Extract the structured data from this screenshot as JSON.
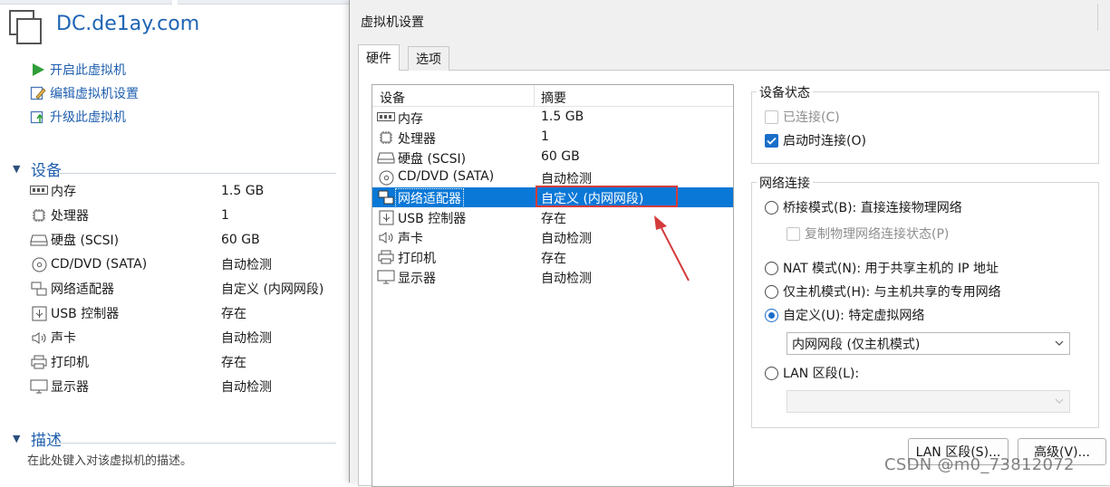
{
  "vm": {
    "title": "DC.de1ay.com"
  },
  "actions": [
    {
      "label": "开启此虚拟机",
      "icon": "play-icon"
    },
    {
      "label": "编辑虚拟机设置",
      "icon": "edit-settings-icon"
    },
    {
      "label": "升级此虚拟机",
      "icon": "upgrade-icon"
    }
  ],
  "devices_section": {
    "title": "设备"
  },
  "devices": [
    {
      "name": "内存",
      "value": "1.5 GB",
      "icon": "memory-icon"
    },
    {
      "name": "处理器",
      "value": "1",
      "icon": "processor-icon"
    },
    {
      "name": "硬盘 (SCSI)",
      "value": "60 GB",
      "icon": "harddisk-icon"
    },
    {
      "name": "CD/DVD (SATA)",
      "value": "自动检测",
      "icon": "cd-dvd-icon"
    },
    {
      "name": "网络适配器",
      "value": "自定义 (内网网段)",
      "icon": "network-adapter-icon"
    },
    {
      "name": "USB 控制器",
      "value": "存在",
      "icon": "usb-icon"
    },
    {
      "name": "声卡",
      "value": "自动检测",
      "icon": "sound-card-icon"
    },
    {
      "name": "打印机",
      "value": "存在",
      "icon": "printer-icon"
    },
    {
      "name": "显示器",
      "value": "自动检测",
      "icon": "display-icon"
    }
  ],
  "description_section": {
    "title": "描述",
    "placeholder": "在此处键入对该虚拟机的描述。"
  },
  "dialog": {
    "title": "虚拟机设置",
    "tabs": [
      {
        "label": "硬件",
        "active": true
      },
      {
        "label": "选项",
        "active": false
      }
    ],
    "list_headers": {
      "device": "设备",
      "summary": "摘要"
    },
    "selected_index": 4,
    "device_status": {
      "title": "设备状态",
      "connected": {
        "label": "已连接(C)",
        "checked": false,
        "enabled": false
      },
      "connect_at_power_on": {
        "label": "启动时连接(O)",
        "checked": true,
        "enabled": true
      }
    },
    "network_connection": {
      "title": "网络连接",
      "bridged": {
        "label": "桥接模式(B): 直接连接物理网络",
        "selected": false
      },
      "replicate": {
        "label": "复制物理网络连接状态(P)",
        "checked": false,
        "enabled": false
      },
      "nat": {
        "label": "NAT 模式(N): 用于共享主机的 IP 地址",
        "selected": false
      },
      "host_only": {
        "label": "仅主机模式(H): 与主机共享的专用网络",
        "selected": false
      },
      "custom": {
        "label": "自定义(U): 特定虚拟网络",
        "selected": true
      },
      "custom_select_value": "内网网段 (仅主机模式)",
      "lan_segment": {
        "label": "LAN 区段(L):",
        "selected": false
      },
      "lan_select_value": ""
    },
    "buttons": {
      "lan_segments": "LAN 区段(S)...",
      "advanced": "高级(V)..."
    }
  },
  "watermark": "CSDN @m0_73812072",
  "colors": {
    "link": "#1f5fae",
    "selection": "#0a78d7",
    "highlight_box": "#d43b3b",
    "arrow": "#d43b3b"
  }
}
